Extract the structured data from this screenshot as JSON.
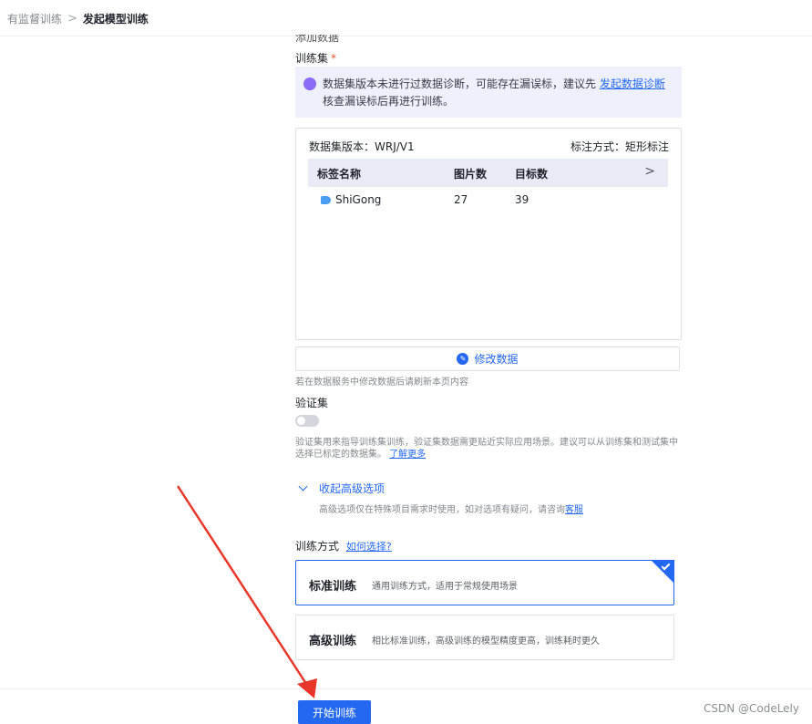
{
  "breadcrumb": {
    "parent": "有监督训练",
    "separator": ">",
    "current": "发起模型训练"
  },
  "cut_label": "添加数据",
  "train_set": {
    "label": "训练集",
    "required_mark": "*",
    "tip_text": "数据集版本未进行过数据诊断，可能存在漏误标，建议先 ",
    "tip_link": "发起数据诊断",
    "tip_text2": "核查漏误标后再进行训练。",
    "dataset_version": "数据集版本：WRJ/V1",
    "label_mode": "标注方式：矩形标注",
    "columns": [
      "标签名称",
      "图片数",
      "目标数"
    ],
    "rows": [
      {
        "name": "ShiGong",
        "images": "27",
        "targets": "39"
      }
    ],
    "edit_button": "修改数据",
    "refresh_hint": "若在数据服务中修改数据后请刷新本页内容"
  },
  "val_set": {
    "label": "验证集",
    "hint_text": "验证集用来指导训练集训练，验证集数据需更贴近实际应用场景。建议可以从训练集和测试集中选择已标定的数据集。",
    "hint_link": "了解更多"
  },
  "advanced": {
    "toggle_label": "收起高级选项",
    "hint_text": "高级选项仅在特殊项目需求时使用，如对选项有疑问，请咨询",
    "hint_link": "客服"
  },
  "training_mode": {
    "label": "训练方式",
    "help_link": "如何选择?",
    "options": [
      {
        "title": "标准训练",
        "desc": "通用训练方式，适用于常规使用场景",
        "selected": true
      },
      {
        "title": "高级训练",
        "desc": "相比标准训练，高级训练的模型精度更高，训练耗时更久",
        "selected": false
      }
    ]
  },
  "footer": {
    "start_button": "开始训练",
    "watermark": "CSDN @CodeLely"
  },
  "colors": {
    "primary": "#2468f2",
    "annotation_arrow": "#e8372a"
  }
}
